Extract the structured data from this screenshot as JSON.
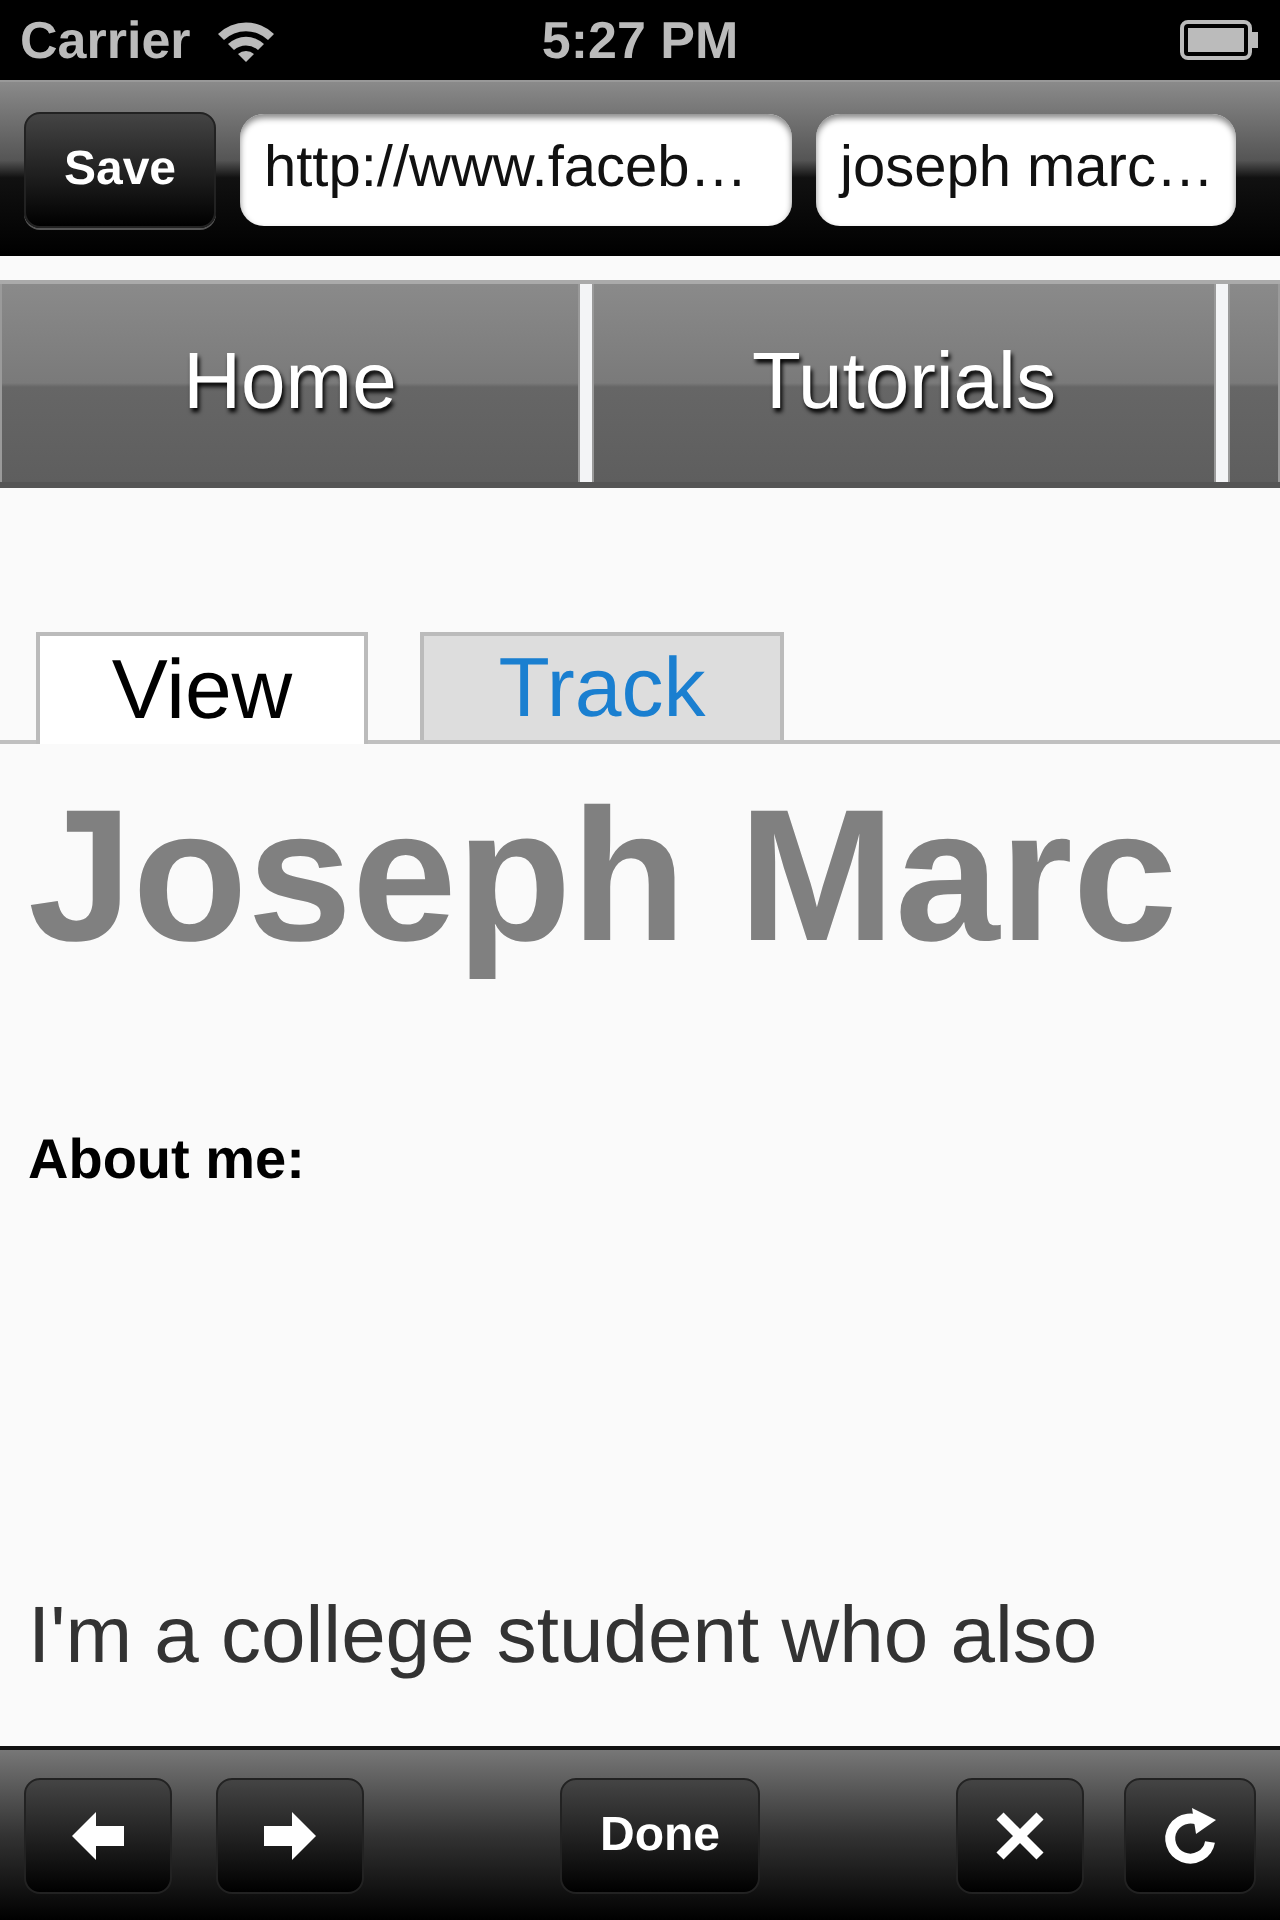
{
  "status_bar": {
    "carrier": "Carrier",
    "time": "5:27 PM"
  },
  "toolbar": {
    "save_button": "Save",
    "url_field": {
      "value": "http://www.faceb…"
    },
    "search_field": {
      "value": "joseph marc…"
    }
  },
  "nav": [
    {
      "label": "Home"
    },
    {
      "label": "Tutorials"
    }
  ],
  "tabs": [
    {
      "label": "View",
      "selected": true
    },
    {
      "label": "Track",
      "selected": false
    }
  ],
  "profile": {
    "name": "Joseph Marc",
    "about_label": "About me:",
    "bio": "I'm a college student who also"
  },
  "bottom_bar": {
    "done_button": "Done"
  }
}
